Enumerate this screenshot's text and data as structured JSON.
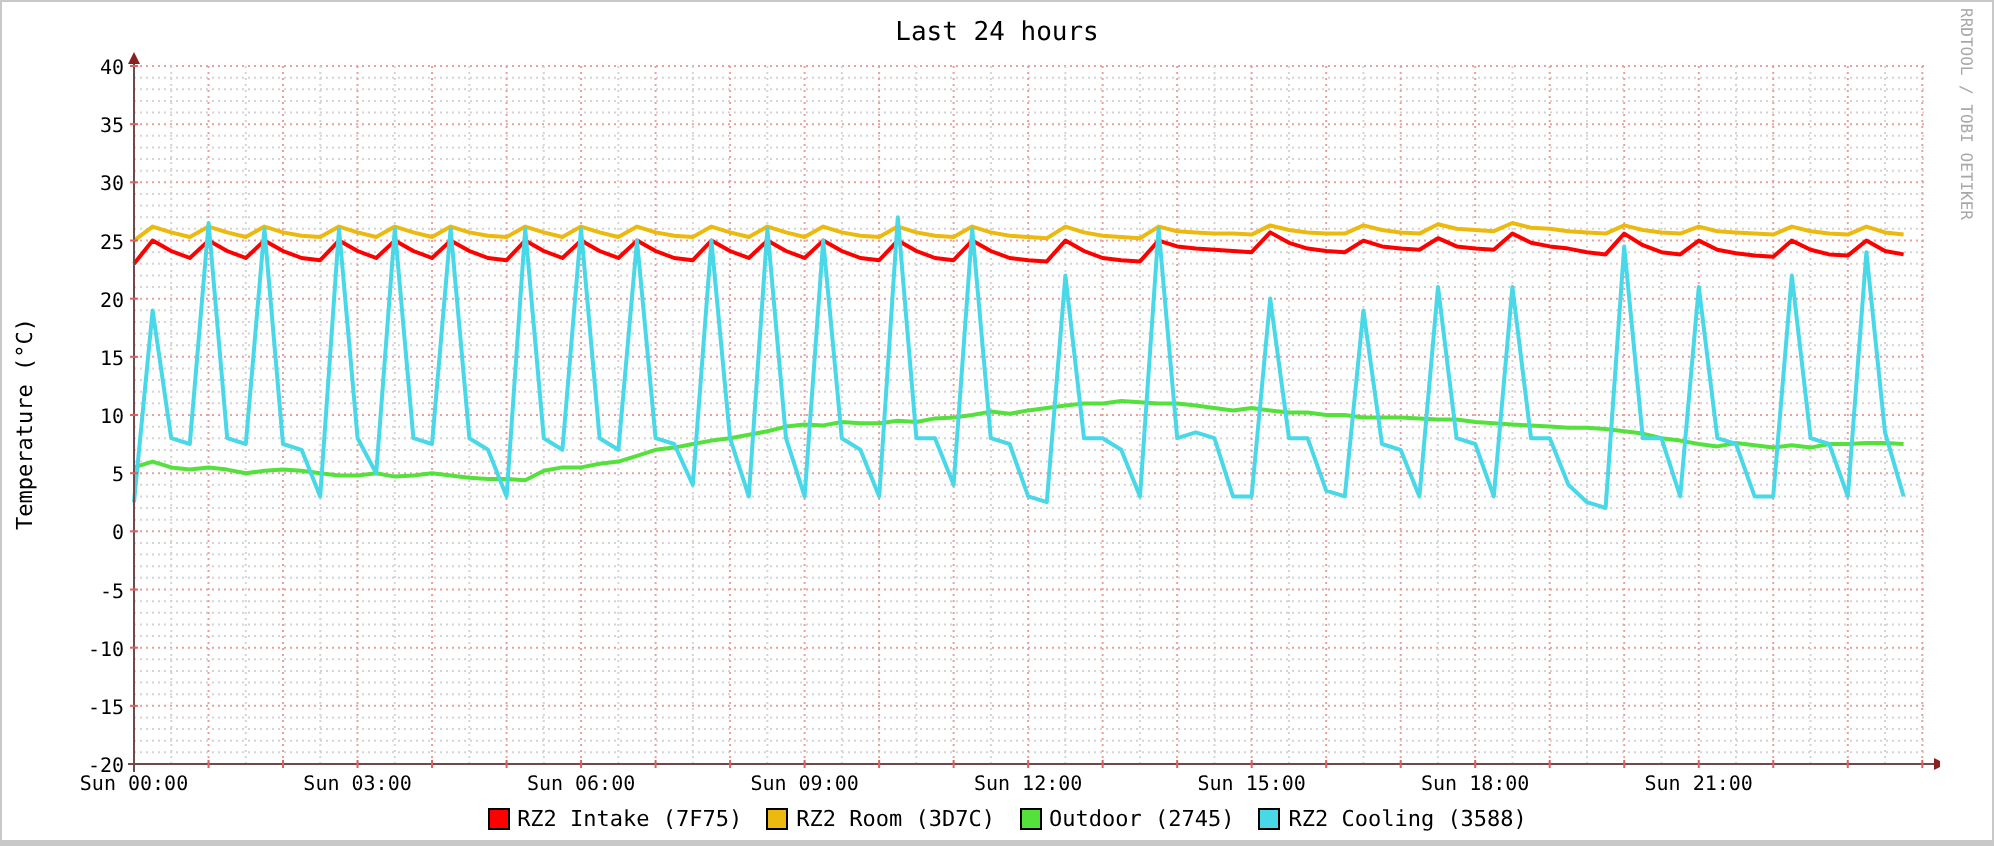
{
  "chart": {
    "credit": "RRDTOOL / TOBI OETIKER",
    "chart_data": {
      "type": "line",
      "title": "Last 24 hours",
      "ylabel": "Temperature (°C)",
      "grid": true,
      "ylim": [
        -20,
        40
      ],
      "yticks": [
        -20,
        -15,
        -10,
        -5,
        0,
        5,
        10,
        15,
        20,
        25,
        30,
        35,
        40
      ],
      "categories": [
        "Sun 00:00",
        null,
        null,
        null,
        null,
        null,
        null,
        null,
        null,
        null,
        null,
        null,
        "Sun 03:00",
        null,
        null,
        null,
        null,
        null,
        null,
        null,
        null,
        null,
        null,
        null,
        "Sun 06:00",
        null,
        null,
        null,
        null,
        null,
        null,
        null,
        null,
        null,
        null,
        null,
        "Sun 09:00",
        null,
        null,
        null,
        null,
        null,
        null,
        null,
        null,
        null,
        null,
        null,
        "Sun 12:00",
        null,
        null,
        null,
        null,
        null,
        null,
        null,
        null,
        null,
        null,
        null,
        "Sun 15:00",
        null,
        null,
        null,
        null,
        null,
        null,
        null,
        null,
        null,
        null,
        null,
        "Sun 18:00",
        null,
        null,
        null,
        null,
        null,
        null,
        null,
        null,
        null,
        null,
        null,
        "Sun 21:00",
        null,
        null,
        null,
        null,
        null,
        null,
        null,
        null,
        null,
        null,
        null
      ],
      "series": [
        {
          "name": "RZ2 Intake (7F75)",
          "color": "#ff0000",
          "values": [
            23,
            25,
            24.1,
            23.5,
            25,
            24.1,
            23.5,
            25,
            24.1,
            23.5,
            23.3,
            25,
            24.1,
            23.5,
            25,
            24.1,
            23.5,
            25,
            24.1,
            23.5,
            23.3,
            25,
            24.1,
            23.5,
            25,
            24.1,
            23.5,
            25,
            24.1,
            23.5,
            23.3,
            25,
            24.1,
            23.5,
            25,
            24.1,
            23.5,
            25,
            24.1,
            23.5,
            23.3,
            25,
            24.1,
            23.5,
            23.3,
            25,
            24.1,
            23.5,
            23.3,
            23.2,
            25,
            24.1,
            23.5,
            23.3,
            23.2,
            25,
            24.5,
            24.3,
            24.2,
            24.1,
            24,
            25.7,
            24.8,
            24.3,
            24.1,
            24,
            25,
            24.5,
            24.3,
            24.2,
            25.2,
            24.5,
            24.3,
            24.2,
            25.6,
            24.8,
            24.5,
            24.3,
            24,
            23.8,
            25.6,
            24.6,
            24,
            23.8,
            25,
            24.2,
            23.9,
            23.7,
            23.6,
            25,
            24.2,
            23.8,
            23.7,
            25,
            24.1,
            23.8
          ]
        },
        {
          "name": "RZ2 Room (3D7C)",
          "color": "#ecb90f",
          "values": [
            25,
            26.2,
            25.7,
            25.3,
            26.2,
            25.7,
            25.3,
            26.2,
            25.7,
            25.4,
            25.3,
            26.2,
            25.7,
            25.3,
            26.2,
            25.7,
            25.3,
            26.2,
            25.7,
            25.4,
            25.3,
            26.2,
            25.7,
            25.3,
            26.2,
            25.7,
            25.3,
            26.2,
            25.7,
            25.4,
            25.3,
            26.2,
            25.7,
            25.3,
            26.2,
            25.7,
            25.3,
            26.2,
            25.7,
            25.4,
            25.3,
            26.2,
            25.7,
            25.4,
            25.3,
            26.2,
            25.7,
            25.4,
            25.3,
            25.2,
            26.2,
            25.7,
            25.4,
            25.3,
            25.2,
            26.2,
            25.8,
            25.7,
            25.6,
            25.6,
            25.5,
            26.3,
            25.9,
            25.7,
            25.6,
            25.6,
            26.3,
            25.9,
            25.7,
            25.6,
            26.4,
            26,
            25.9,
            25.8,
            26.5,
            26.1,
            26,
            25.8,
            25.7,
            25.6,
            26.3,
            25.9,
            25.7,
            25.6,
            26.2,
            25.8,
            25.7,
            25.6,
            25.5,
            26.2,
            25.8,
            25.6,
            25.5,
            26.2,
            25.7,
            25.5
          ]
        },
        {
          "name": "Outdoor (2745)",
          "color": "#54e13c",
          "values": [
            5.5,
            6,
            5.5,
            5.3,
            5.5,
            5.3,
            5,
            5.2,
            5.3,
            5.2,
            5,
            4.8,
            4.8,
            5,
            4.7,
            4.8,
            5,
            4.8,
            4.6,
            4.5,
            4.5,
            4.4,
            5.2,
            5.5,
            5.5,
            5.8,
            6,
            6.5,
            7,
            7.2,
            7.5,
            7.8,
            8,
            8.3,
            8.6,
            9,
            9.2,
            9.1,
            9.4,
            9.3,
            9.3,
            9.5,
            9.4,
            9.7,
            9.8,
            10,
            10.3,
            10.1,
            10.4,
            10.6,
            10.8,
            11,
            11,
            11.2,
            11.1,
            11,
            11,
            10.8,
            10.6,
            10.4,
            10.6,
            10.4,
            10.2,
            10.2,
            10,
            10,
            9.8,
            9.8,
            9.8,
            9.7,
            9.6,
            9.6,
            9.4,
            9.3,
            9.2,
            9.1,
            9,
            8.9,
            8.9,
            8.8,
            8.6,
            8.4,
            8,
            7.8,
            7.5,
            7.3,
            7.6,
            7.4,
            7.2,
            7.4,
            7.2,
            7.5,
            7.5,
            7.6,
            7.6,
            7.5
          ]
        },
        {
          "name": "RZ2 Cooling (3588)",
          "color": "#48d8e8",
          "values": [
            2.5,
            19,
            8,
            7.5,
            26.5,
            8,
            7.5,
            26,
            7.5,
            7,
            3,
            26,
            8,
            5,
            26,
            8,
            7.5,
            26,
            8,
            7,
            3,
            26,
            8,
            7,
            26,
            8,
            7,
            25,
            8,
            7.5,
            4,
            25,
            8,
            3,
            26,
            8,
            3,
            25,
            8,
            7,
            3,
            27,
            8,
            8,
            4,
            26,
            8,
            7.5,
            3,
            2.5,
            22,
            8,
            8,
            7,
            3,
            26,
            8,
            8.5,
            8,
            3,
            3,
            20,
            8,
            8,
            3.5,
            3,
            19,
            7.5,
            7,
            3,
            21,
            8,
            7.5,
            3,
            21,
            8,
            8,
            4,
            2.5,
            2,
            24.5,
            8,
            8,
            3,
            21,
            8,
            7.5,
            3,
            3,
            22,
            8,
            7.5,
            3,
            24,
            8.5,
            3
          ]
        }
      ]
    }
  }
}
